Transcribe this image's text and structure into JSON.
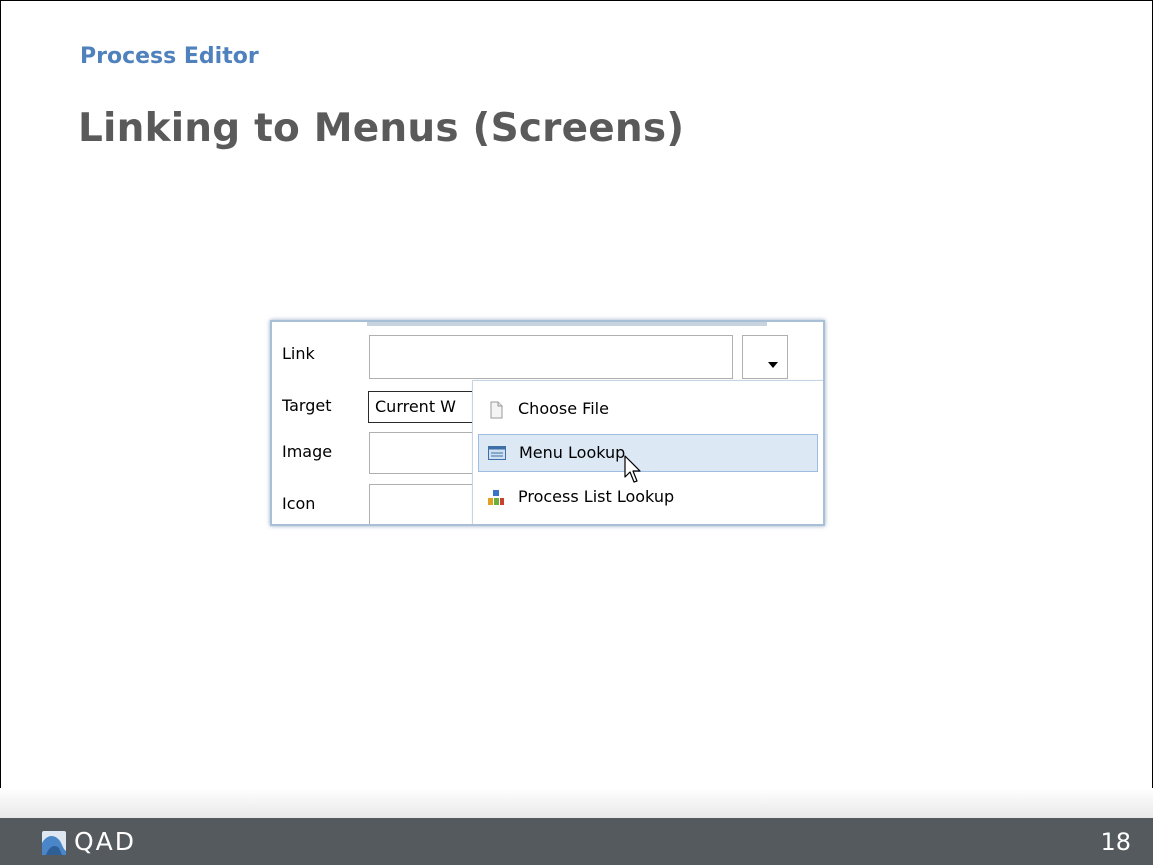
{
  "slide": {
    "section_title": "Process Editor",
    "title": "Linking to Menus (Screens)",
    "page_number": "18"
  },
  "form": {
    "link_label": "Link",
    "link_value": "",
    "target_label": "Target",
    "target_value": "Current W",
    "image_label": "Image",
    "image_value": "",
    "icon_label": "Icon",
    "icon_value": ""
  },
  "dropdown": {
    "items": [
      {
        "label": "Choose File",
        "icon": "file-icon",
        "highlighted": false
      },
      {
        "label": "Menu Lookup",
        "icon": "menu-lookup-icon",
        "highlighted": true
      },
      {
        "label": "Process List Lookup",
        "icon": "process-list-icon",
        "highlighted": false
      }
    ]
  },
  "footer": {
    "brand": "QAD",
    "logo_icon": "qad-logo-icon"
  },
  "colors": {
    "section_title": "#4f81bd",
    "title": "#5a5a5a",
    "footer_bg": "#555a5e",
    "highlight_bg": "#dde8f5",
    "highlight_border": "#9fbde0"
  }
}
